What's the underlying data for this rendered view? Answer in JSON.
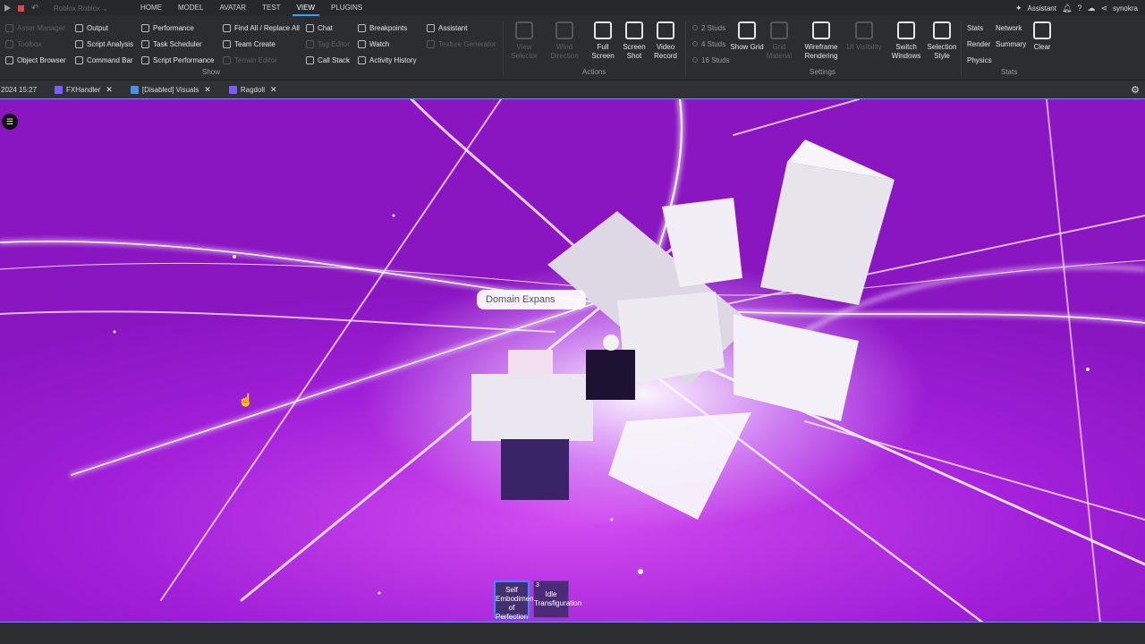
{
  "app": {
    "place_dropdown": "Roblox Roblox"
  },
  "menu": {
    "items": [
      "HOME",
      "MODEL",
      "AVATAR",
      "TEST",
      "VIEW",
      "PLUGINS"
    ],
    "active": "VIEW"
  },
  "topbar_right": {
    "assistant": "Assistant",
    "user": "synokra"
  },
  "ribbon": {
    "show": {
      "col1": [
        {
          "label": "Asset Manager",
          "disabled": true
        },
        {
          "label": "Toolbox",
          "disabled": true
        },
        {
          "label": "Object Browser",
          "disabled": false
        }
      ],
      "col2": [
        {
          "label": "Output",
          "disabled": false
        },
        {
          "label": "Script Analysis",
          "disabled": false
        },
        {
          "label": "Command Bar",
          "disabled": false
        }
      ],
      "col3": [
        {
          "label": "Performance",
          "disabled": false
        },
        {
          "label": "Task Scheduler",
          "disabled": false
        },
        {
          "label": "Script Performance",
          "disabled": false
        }
      ],
      "col4": [
        {
          "label": "Find All / Replace All",
          "disabled": false
        },
        {
          "label": "Team Create",
          "disabled": false
        },
        {
          "label": "Terrain Editor",
          "disabled": true
        }
      ],
      "col5": [
        {
          "label": "Chat",
          "disabled": false
        },
        {
          "label": "Tag Editor",
          "disabled": true
        },
        {
          "label": "Call Stack",
          "disabled": false
        }
      ],
      "col6": [
        {
          "label": "Breakpoints",
          "disabled": false
        },
        {
          "label": "Watch",
          "disabled": false
        },
        {
          "label": "Activity History",
          "disabled": false
        }
      ],
      "col7": [
        {
          "label": "Assistant",
          "disabled": false
        },
        {
          "label": "Texture Generator",
          "disabled": true
        }
      ],
      "group_label": "Show"
    },
    "actions": {
      "view_selector": "View Selector",
      "wind_direction": "Wind Direction",
      "full_screen": "Full Screen",
      "screen_shot": "Screen Shot",
      "video_record": "Video Record",
      "group_label": "Actions"
    },
    "settings": {
      "studs": [
        "2 Studs",
        "4 Studs",
        "16 Studs"
      ],
      "show_grid": "Show Grid",
      "grid_material": "Grid Material",
      "wireframe_rendering": "Wireframe Rendering",
      "ui_visibility": "UI Visibility",
      "switch_windows": "Switch Windows",
      "selection_style": "Selection Style",
      "group_label": "Settings"
    },
    "stats": {
      "stats": "Stats",
      "network": "Network",
      "render": "Render",
      "summary": "Summary",
      "physics": "Physics",
      "clear": "Clear",
      "group_label": "Stats"
    }
  },
  "tabs": [
    {
      "label": "2024 15:27",
      "icon": "none"
    },
    {
      "label": "FXHandler",
      "icon": "script-icon"
    },
    {
      "label": "[Disabled] Visuals",
      "icon": "disabled-script-icon"
    },
    {
      "label": "Ragdoll",
      "icon": "script-icon"
    }
  ],
  "viewport": {
    "tooltip": "Domain Expans",
    "hotbar": [
      {
        "num": "",
        "label": "Self Embodiment of Perfection",
        "selected": true
      },
      {
        "num": "3",
        "label": "Idle Transfiguration",
        "selected": false
      }
    ]
  }
}
